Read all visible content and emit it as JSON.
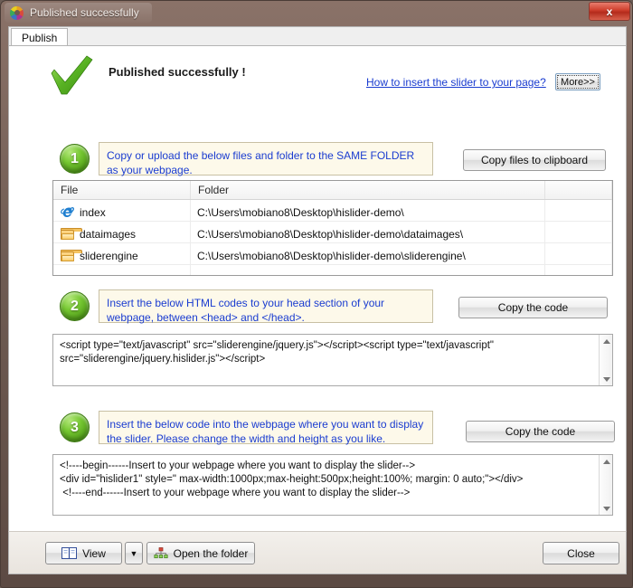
{
  "window": {
    "title": "Published successfully",
    "app_icon": "color-wheel-icon",
    "close_label": "x"
  },
  "tab": {
    "label": "Publish"
  },
  "header": {
    "check_icon": "green-check-icon",
    "headline": "Published successfully !",
    "help_link": "How to insert the slider to your page?",
    "more_button": "More>>"
  },
  "steps": [
    {
      "number": "1",
      "note": "Copy or upload the below files and folder to the SAME FOLDER as your webpage.",
      "button": "Copy files to clipboard"
    },
    {
      "number": "2",
      "note": "Insert  the below HTML codes to your head section of your webpage, between <head> and </head>.",
      "button": "Copy the code",
      "code": "<script type=\"text/javascript\" src=\"sliderengine/jquery.js\"></script><script type=\"text/javascript\" src=\"sliderengine/jquery.hislider.js\"></script>"
    },
    {
      "number": "3",
      "note": "Insert the below code into the webpage where you want to display the slider. Please change the width and height as you like.",
      "button": "Copy the code",
      "code": "<!----begin------Insert to your webpage where you want to display the slider-->\n<div id=\"hislider1\" style=\" max-width:1000px;max-height:500px;height:100%; margin: 0 auto;\"></div>\n <!----end------Insert to your webpage where you want to display the slider-->"
    }
  ],
  "file_table": {
    "columns": [
      "File",
      "Folder",
      ""
    ],
    "rows": [
      {
        "icon": "internet-explorer-icon",
        "file": "index",
        "folder": "C:\\Users\\mobiano8\\Desktop\\hislider-demo\\"
      },
      {
        "icon": "folder-icon",
        "file": "dataimages",
        "folder": "C:\\Users\\mobiano8\\Desktop\\hislider-demo\\dataimages\\"
      },
      {
        "icon": "folder-icon",
        "file": "sliderengine",
        "folder": "C:\\Users\\mobiano8\\Desktop\\hislider-demo\\sliderengine\\"
      }
    ]
  },
  "footer": {
    "view_button": "View",
    "view_dropdown": "▼",
    "open_folder_button": "Open the folder",
    "close_button": "Close"
  },
  "colors": {
    "accent_link": "#1a3cd0",
    "note_bg": "#fdf9ea",
    "badge_green": "#76c832",
    "title_bar": "#6e5b52"
  }
}
